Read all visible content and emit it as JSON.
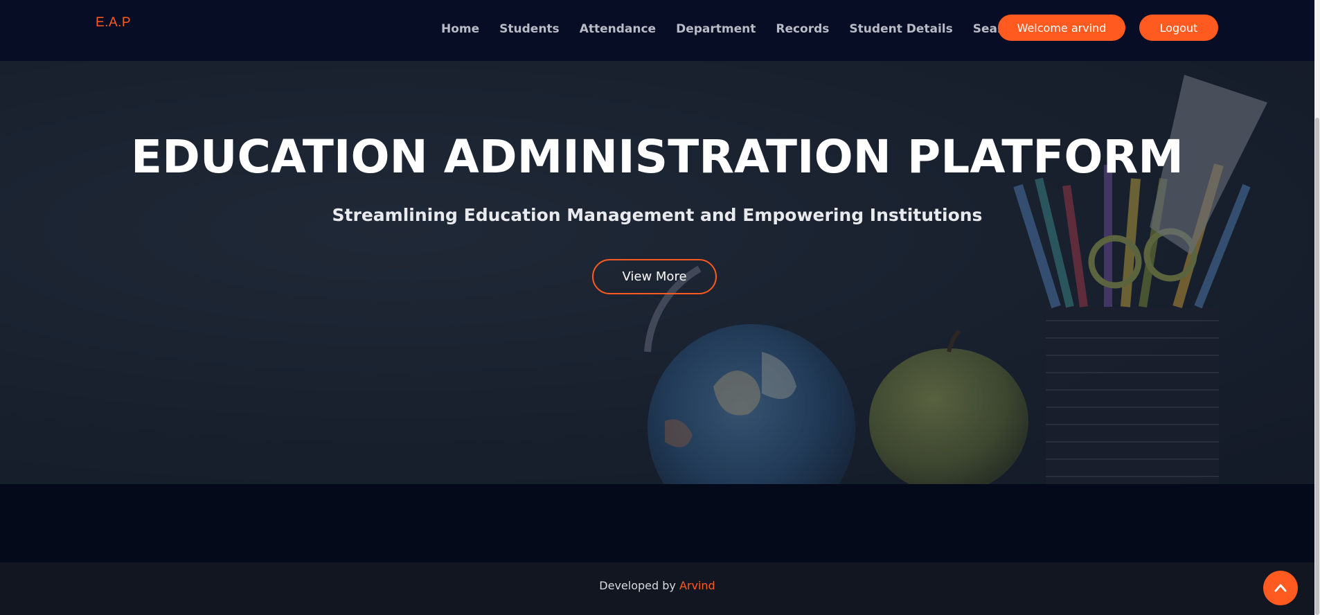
{
  "header": {
    "logo": "E.A.P",
    "nav": [
      {
        "label": "Home"
      },
      {
        "label": "Students"
      },
      {
        "label": "Attendance"
      },
      {
        "label": "Department"
      },
      {
        "label": "Records"
      },
      {
        "label": "Student Details"
      },
      {
        "label": "Search"
      }
    ],
    "welcome_label": "Welcome arvind",
    "logout_label": "Logout"
  },
  "hero": {
    "title": "EDUCATION ADMINISTRATION PLATFORM",
    "subtitle": "Streamlining Education Management and Empowering Institutions",
    "cta_label": "View More",
    "background_icons": [
      "globe-icon",
      "apple-icon",
      "pencil-cup-icon"
    ]
  },
  "footer": {
    "prefix": "Developed by ",
    "author": "Arvind"
  },
  "scroll_top_icon": "chevron-up-icon",
  "colors": {
    "accent": "#ff5a1f",
    "header_bg": "#070d24",
    "page_bg": "#040a1a",
    "footer_bg": "#111621"
  }
}
